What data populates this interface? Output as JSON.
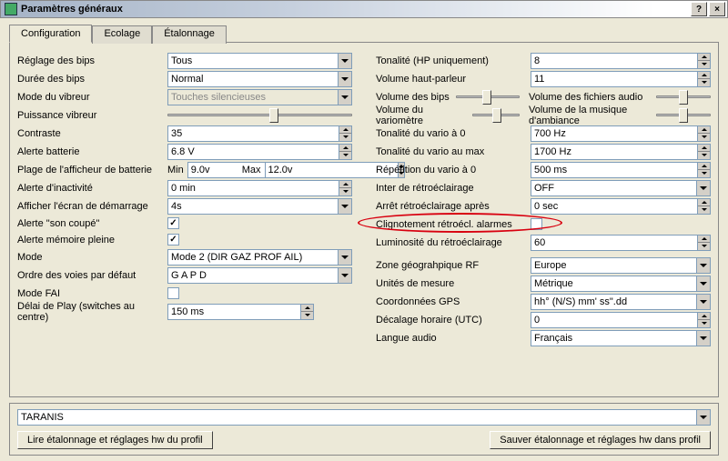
{
  "window": {
    "title": "Paramètres généraux"
  },
  "tabs": {
    "config": "Configuration",
    "ecolage": "Ecolage",
    "etalonnage": "Étalonnage"
  },
  "left": {
    "beepSettingsLabel": "Réglage des bips",
    "beepSettingsValue": "Tous",
    "beepDurationLabel": "Durée des bips",
    "beepDurationValue": "Normal",
    "vibModeLabel": "Mode du vibreur",
    "vibModeValue": "Touches silencieuses",
    "vibPowerLabel": "Puissance vibreur",
    "contrastLabel": "Contraste",
    "contrastValue": "35",
    "batteryAlertLabel": "Alerte batterie",
    "batteryAlertValue": "6.8 V",
    "batteryRangeLabel": "Plage de l'afficheur de batterie",
    "minLabel": "Min",
    "minValue": "9.0v",
    "maxLabel": "Max",
    "maxValue": "12.0v",
    "inactivityLabel": "Alerte d'inactivité",
    "inactivityValue": "0 min",
    "splashLabel": "Afficher l'écran de démarrage",
    "splashValue": "4s",
    "soundOffAlertLabel": "Alerte \"son coupé\"",
    "memFullAlertLabel": "Alerte mémoire pleine",
    "modeLabel": "Mode",
    "modeValue": "Mode 2 (DIR GAZ PROF AIL)",
    "chanOrderLabel": "Ordre des voies par défaut",
    "chanOrderValue": "G A P D",
    "faiLabel": "Mode FAI",
    "playDelayLabel": "Délai de Play (switches au centre)",
    "playDelayValue": "150 ms"
  },
  "right": {
    "toneHpLabel": "Tonalité (HP uniquement)",
    "toneHpValue": "8",
    "volHpLabel": "Volume haut-parleur",
    "volHpValue": "11",
    "volBipsLabel": "Volume des bips",
    "volAudioFilesLabel": "Volume des fichiers audio",
    "volVarioLabel": "Volume du variomètre",
    "volAmbianceLabel": "Volume de la musique d'ambiance",
    "vario0Label": "Tonalité du vario à 0",
    "vario0Value": "700 Hz",
    "varioMaxLabel": "Tonalité du vario au max",
    "varioMaxValue": "1700 Hz",
    "varioRepLabel": "Répétition du vario à 0",
    "varioRepValue": "500 ms",
    "backlightSwLabel": "Inter de rétroéclairage",
    "backlightSwValue": "OFF",
    "backlightStopLabel": "Arrêt rétroéclairage après",
    "backlightStopValue": "0 sec",
    "flashAlarmLabel": "Clignotement rétroécl. alarmes",
    "backlightLumLabel": "Luminosité du rétroéclairage",
    "backlightLumValue": "60",
    "geoZoneLabel": "Zone géograhpique RF",
    "geoZoneValue": "Europe",
    "unitsLabel": "Unités de mesure",
    "unitsValue": "Métrique",
    "gpsLabel": "Coordonnées GPS",
    "gpsValue": "hh° (N/S) mm' ss\".dd",
    "utcLabel": "Décalage horaire (UTC)",
    "utcValue": "0",
    "audioLangLabel": "Langue audio",
    "audioLangValue": "Français"
  },
  "bottom": {
    "profileValue": "TARANIS",
    "readBtn": "Lire étalonnage et réglages hw du profil",
    "saveBtn": "Sauver étalonnage et réglages hw dans profil"
  }
}
